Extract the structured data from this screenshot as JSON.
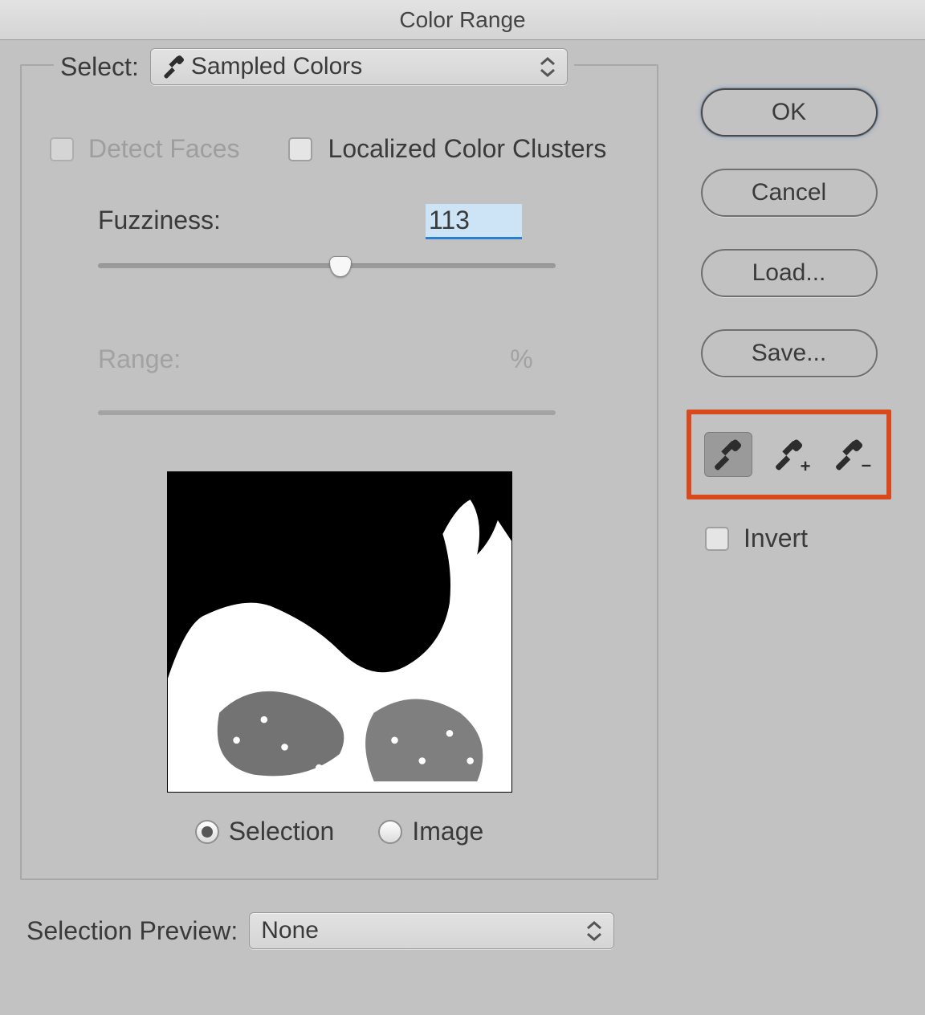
{
  "title": "Color Range",
  "select": {
    "label": "Select:",
    "value": "Sampled Colors"
  },
  "detect_faces": {
    "label": "Detect Faces",
    "checked": false,
    "enabled": false
  },
  "localized": {
    "label": "Localized Color Clusters",
    "checked": false
  },
  "fuzziness": {
    "label": "Fuzziness:",
    "value": "113",
    "min": 0,
    "max": 200,
    "thumb_pct": 53
  },
  "range": {
    "label": "Range:",
    "unit": "%",
    "enabled": false
  },
  "radios": {
    "selection": "Selection",
    "image": "Image",
    "checked": "selection"
  },
  "selection_preview": {
    "label": "Selection Preview:",
    "value": "None"
  },
  "buttons": {
    "ok": "OK",
    "cancel": "Cancel",
    "load": "Load...",
    "save": "Save..."
  },
  "invert": {
    "label": "Invert",
    "checked": false
  },
  "icons": {
    "eyedropper": "eyedropper-icon",
    "eyedropper_plus": "eyedropper-plus-icon",
    "eyedropper_minus": "eyedropper-minus-icon",
    "chevrons": "chevrons-icon"
  }
}
